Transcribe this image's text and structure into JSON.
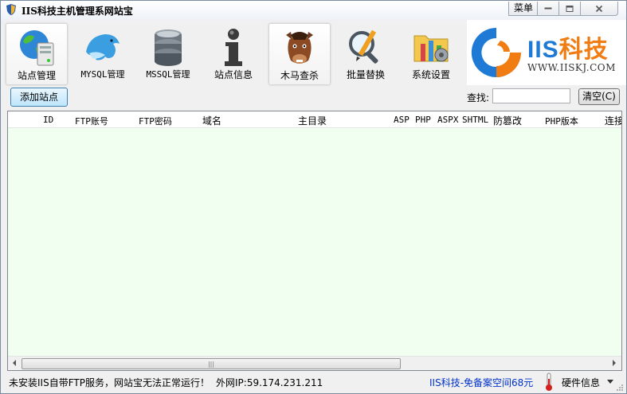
{
  "window": {
    "title": "IIS科技主机管理系网站宝",
    "menu_label": "菜单"
  },
  "toolbar": {
    "items": [
      {
        "label": "站点管理",
        "icon": "globe-server-icon",
        "selected": true
      },
      {
        "label": "MYSQL管理",
        "icon": "dolphin-icon"
      },
      {
        "label": "MSSQL管理",
        "icon": "database-icon"
      },
      {
        "label": "站点信息",
        "icon": "info-icon"
      },
      {
        "label": "木马查杀",
        "icon": "horse-icon"
      },
      {
        "label": "批量替换",
        "icon": "magnifier-pencil-icon"
      },
      {
        "label": "系统设置",
        "icon": "settings-folder-icon"
      }
    ]
  },
  "logo": {
    "brand_main": "IIS",
    "brand_accent": "科技",
    "url": "WWW.IISKJ.COM",
    "colors": {
      "blue": "#1f7ad6",
      "orange": "#f07c12"
    }
  },
  "actions": {
    "add_site": "添加站点",
    "search_label": "查找:",
    "search_value": "",
    "clear_label": "清空(C)"
  },
  "grid": {
    "columns": [
      "ID",
      "FTP账号",
      "FTP密码",
      "域名",
      "主目录",
      "ASP",
      "PHP",
      "ASPX",
      "SHTML",
      "防篡改",
      "PHP版本",
      "连接"
    ],
    "rows": [],
    "background": "#f0fff0"
  },
  "status": {
    "message": "未安装IIS自带FTP服务，网站宝无法正常运行！",
    "ip": "外网IP:59.174.231.211",
    "ad": "IIS科技-免备案空间68元",
    "hardware": "硬件信息"
  }
}
